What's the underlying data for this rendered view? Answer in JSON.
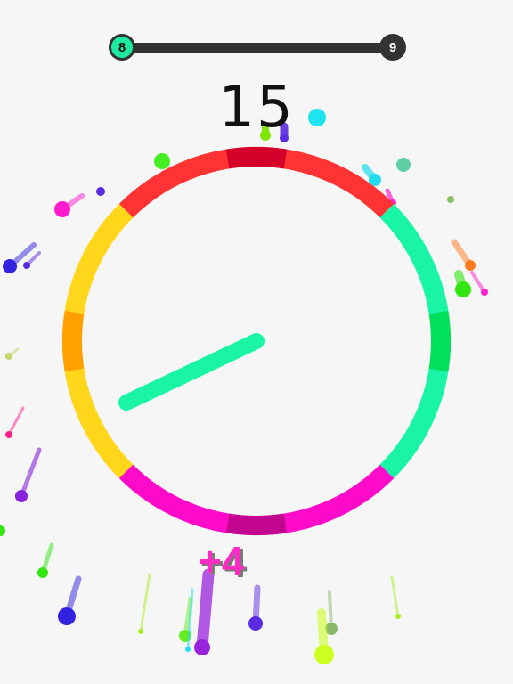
{
  "hud": {
    "level_current": "8",
    "level_next": "9",
    "level_progress": 0.0,
    "score": "15",
    "bonus": "+4"
  },
  "colors": {
    "background": "#f6f6f6",
    "bar": "#333333",
    "current_level": "#1de9a0",
    "red": "#ff3333",
    "red_dark": "#d4002a",
    "green": "#19f5a5",
    "green_dark": "#00e05a",
    "magenta": "#ff0ac8",
    "magenta_dark": "#c2068f",
    "yellow": "#ffd61a",
    "orange": "#ffa000",
    "needle": "#19f5a5",
    "bonus": "#ff2bc2"
  },
  "wheel": {
    "segments": [
      {
        "name": "red",
        "color": "#ff3333",
        "accent": "#d4002a"
      },
      {
        "name": "green",
        "color": "#19f5a5",
        "accent": "#00e05a"
      },
      {
        "name": "magenta",
        "color": "#ff0ac8",
        "accent": "#c2068f"
      },
      {
        "name": "yellow",
        "color": "#ffd61a",
        "accent": "#ffa000"
      }
    ]
  },
  "needle": {
    "color": "#19f5a5"
  }
}
